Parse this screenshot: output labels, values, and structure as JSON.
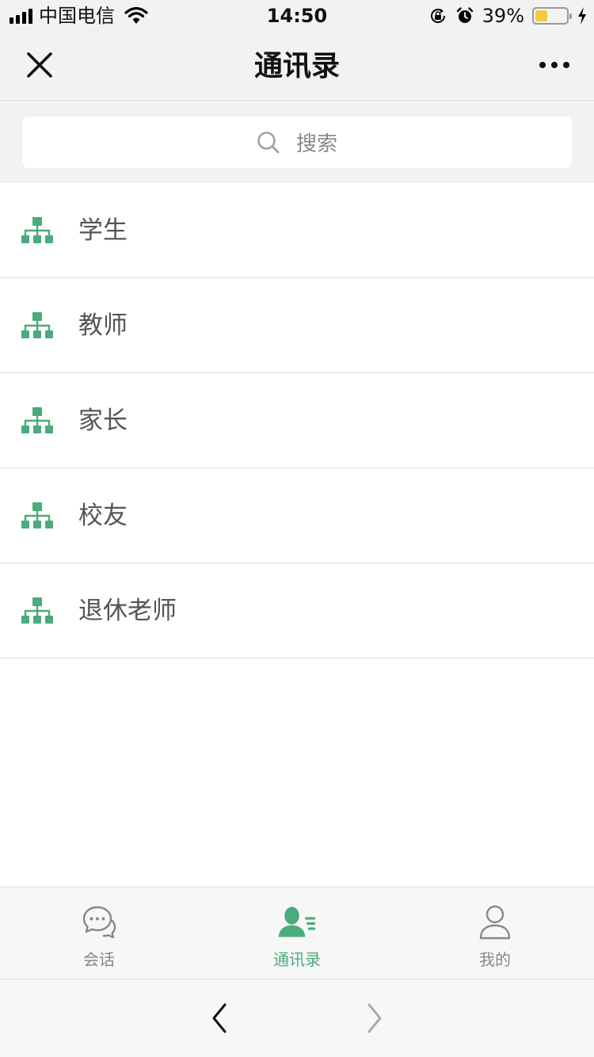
{
  "status_bar": {
    "carrier": "中国电信",
    "time": "14:50",
    "battery_percent_label": "39%",
    "battery_level": 0.39,
    "icons": [
      "signal-icon",
      "wifi-icon",
      "rotation-lock-icon",
      "alarm-icon",
      "battery-icon",
      "charging-icon"
    ]
  },
  "nav": {
    "title": "通讯录",
    "close_icon": "close-icon",
    "more_icon": "more-icon"
  },
  "search": {
    "placeholder": "搜索",
    "icon": "search-icon"
  },
  "contacts": {
    "icon": "org-chart-icon",
    "icon_color": "#4aab7c",
    "items": [
      {
        "label": "学生"
      },
      {
        "label": "教师"
      },
      {
        "label": "家长"
      },
      {
        "label": "校友"
      },
      {
        "label": "退休老师"
      }
    ]
  },
  "tab_bar": {
    "active_color": "#4aab7c",
    "inactive_color": "#888888",
    "tabs": [
      {
        "label": "会话",
        "icon": "chat-icon",
        "active": false
      },
      {
        "label": "通讯录",
        "icon": "contacts-icon",
        "active": true
      },
      {
        "label": "我的",
        "icon": "profile-icon",
        "active": false
      }
    ]
  },
  "browser_bar": {
    "back_icon": "chevron-left-icon",
    "forward_icon": "chevron-right-icon"
  }
}
